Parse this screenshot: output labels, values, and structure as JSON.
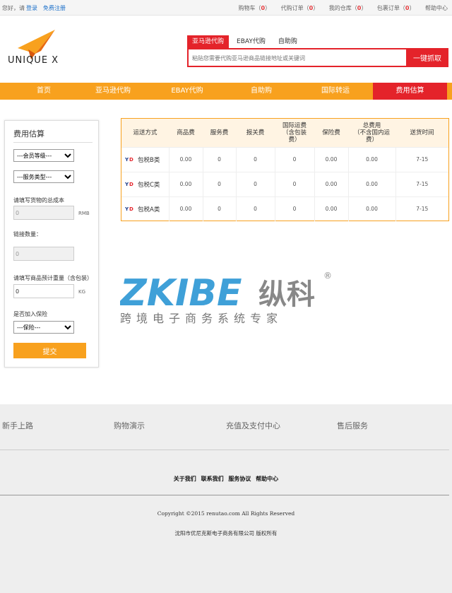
{
  "topbar": {
    "greeting": "您好，请",
    "login": "登录",
    "register": "免费注册",
    "links": [
      {
        "label": "购物车（",
        "count": "0",
        "end": "）"
      },
      {
        "label": "代购订单（",
        "count": "0",
        "end": "）"
      },
      {
        "label": "我的仓库（",
        "count": "0",
        "end": "）"
      },
      {
        "label": "包裹订单（",
        "count": "0",
        "end": "）"
      }
    ],
    "help": "帮助中心"
  },
  "brand": {
    "name": "UNIQUE X",
    "colors": {
      "orange": "#f8a11e",
      "red": "#e4232a"
    }
  },
  "search": {
    "tabs": [
      "亚马逊代购",
      "EBAY代购",
      "自助购"
    ],
    "placeholder": "粘贴您需要代购亚马逊商品链接地址或关键词",
    "button": "一键抓取"
  },
  "nav": {
    "items": [
      "首页",
      "亚马逊代购",
      "EBAY代购",
      "自助购",
      "国际转运",
      "费用估算"
    ],
    "active": "费用估算"
  },
  "estimator": {
    "title": "费用估算",
    "member_level": "---会员等级---",
    "service_type": "---服务类型---",
    "cost_label": "请填写货物的总成本",
    "cost_value": "0",
    "cost_unit": "RMB",
    "link_count_label": "链接数量：",
    "link_count_value": "0",
    "weight_label": "请填写商品预计重量（含包装）",
    "weight_value": "0",
    "weight_unit": "KG",
    "insurance_label": "是否加入保险",
    "insurance_value": "---保险---",
    "submit": "提交"
  },
  "results": {
    "headers": [
      "运送方式",
      "商品费",
      "服务费",
      "报关费",
      "国际运费\n（含包装\n费）",
      "保险费",
      "总费用\n（不含国内运\n费）",
      "送货时间"
    ],
    "rows": [
      {
        "icon": "yd-logo-icon",
        "method": "包税B类",
        "goods": "0.00",
        "service": "0",
        "customs": "0",
        "intl": "0",
        "insurance": "0.00",
        "total": "0.00",
        "time": "7-15"
      },
      {
        "icon": "yd-logo-icon",
        "method": "包税C类",
        "goods": "0.00",
        "service": "0",
        "customs": "0",
        "intl": "0",
        "insurance": "0.00",
        "total": "0.00",
        "time": "7-15"
      },
      {
        "icon": "yd-logo-icon",
        "method": "包税A类",
        "goods": "0.00",
        "service": "0",
        "customs": "0",
        "intl": "0",
        "insurance": "0.00",
        "total": "0.00",
        "time": "7-15"
      }
    ]
  },
  "watermark": {
    "brand": "ZKIBE",
    "cn": "纵科",
    "reg": "®",
    "sub": "跨境电子商务系统专家"
  },
  "footer": {
    "columns": [
      "新手上路",
      "购物演示",
      "充值及支付中心",
      "售后服务"
    ],
    "links": [
      "关于我们",
      "联系我们",
      "服务协议",
      "帮助中心"
    ],
    "copyright": "Copyright ©2015 renutao.com All Rights Reserved",
    "company": "沈阳市优尼克斯电子商务有限公司 版权所有"
  }
}
